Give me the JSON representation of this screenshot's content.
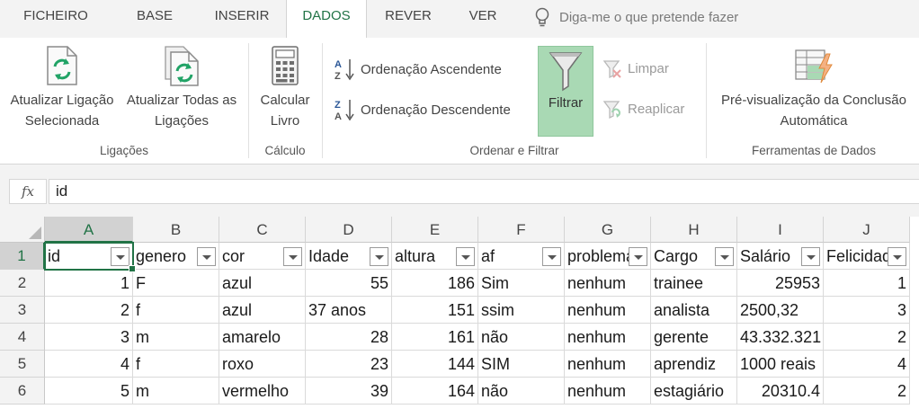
{
  "tabs": [
    {
      "label": "FICHEIRO"
    },
    {
      "label": "BASE"
    },
    {
      "label": "INSERIR"
    },
    {
      "label": "DADOS"
    },
    {
      "label": "REVER"
    },
    {
      "label": "VER"
    }
  ],
  "active_tab": "DADOS",
  "tell_me": {
    "placeholder": "Diga-me o que pretende fazer",
    "icon": "lightbulb-icon"
  },
  "ribbon": {
    "ligacoes": {
      "group_label": "Ligações",
      "refresh_selected": {
        "label": "Atualizar Ligação\nSelecionada",
        "icon": "refresh-document-icon"
      },
      "refresh_all": {
        "label": "Atualizar Todas as\nLigações",
        "icon": "refresh-documents-icon"
      }
    },
    "calculo": {
      "group_label": "Cálculo",
      "calculate": {
        "label": "Calcular\nLivro",
        "icon": "calculator-icon"
      }
    },
    "ordenar": {
      "group_label": "Ordenar e Filtrar",
      "sort_asc": {
        "label": "Ordenação Ascendente",
        "icon": "sort-az-icon"
      },
      "sort_desc": {
        "label": "Ordenação Descendente",
        "icon": "sort-za-icon"
      },
      "filter": {
        "label": "Filtrar",
        "icon": "funnel-icon",
        "active": true
      },
      "clear": {
        "label": "Limpar",
        "icon": "clear-filter-icon",
        "enabled": false
      },
      "reapply": {
        "label": "Reaplicar",
        "icon": "reapply-filter-icon",
        "enabled": false
      }
    },
    "ferramentas": {
      "group_label": "Ferramentas de Dados",
      "flash_fill": {
        "label": "Pré-visualização da Conclusão\nAutomática",
        "icon": "flash-fill-icon"
      }
    }
  },
  "formula_bar": {
    "fx_label": "fx",
    "value": "id"
  },
  "sheet": {
    "columns": [
      "A",
      "B",
      "C",
      "D",
      "E",
      "F",
      "G",
      "H",
      "I",
      "J"
    ],
    "rows": [
      "1",
      "2",
      "3",
      "4",
      "5",
      "6"
    ],
    "active_cell": "A1",
    "header_row": [
      "id",
      "genero",
      "cor",
      "Idade",
      "altura",
      "af",
      "problema",
      "Cargo",
      "Salário",
      "Felicidade"
    ],
    "data_rows": [
      [
        "1",
        "F",
        "azul",
        "55",
        "186",
        "Sim",
        "nenhum",
        "trainee",
        "25953",
        "1"
      ],
      [
        "2",
        "f",
        "azul",
        "37 anos",
        "151",
        "ssim",
        "nenhum",
        "analista",
        "2500,32",
        "3"
      ],
      [
        "3",
        "m",
        "amarelo",
        "28",
        "161",
        "não",
        "nenhum",
        "gerente",
        "43.332.321",
        "2"
      ],
      [
        "4",
        "f",
        "roxo",
        "23",
        "144",
        "SIM",
        "nenhum",
        "aprendiz",
        "1000 reais",
        "4"
      ],
      [
        "5",
        "m",
        "vermelho",
        "39",
        "164",
        "não",
        "nenhum",
        "estagiário",
        "20310.4",
        "2"
      ]
    ]
  },
  "colors": {
    "accent_green": "#217346",
    "filter_active_bg": "#a9d9b4"
  }
}
